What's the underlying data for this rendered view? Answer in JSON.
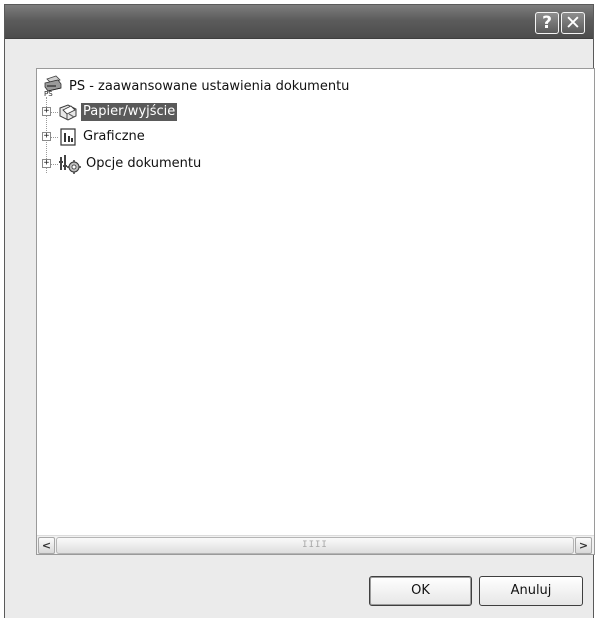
{
  "window": {
    "title_buttons": {
      "help": "?",
      "close": "✕"
    }
  },
  "tree": {
    "root": {
      "label": "PS - zaawansowane ustawienia dokumentu",
      "icon": "printer-ps-icon"
    },
    "items": [
      {
        "label": "Papier/wyjście",
        "icon": "paper-output-icon",
        "expander": "+",
        "selected": true
      },
      {
        "label": "Graficzne",
        "icon": "graphics-icon",
        "expander": "+",
        "selected": false
      },
      {
        "label": "Opcje dokumentu",
        "icon": "document-options-icon",
        "expander": "+",
        "selected": false
      }
    ]
  },
  "scrollbar": {
    "left_arrow": "<",
    "right_arrow": ">",
    "grip": "IIII"
  },
  "buttons": {
    "ok": "OK",
    "cancel": "Anuluj"
  }
}
